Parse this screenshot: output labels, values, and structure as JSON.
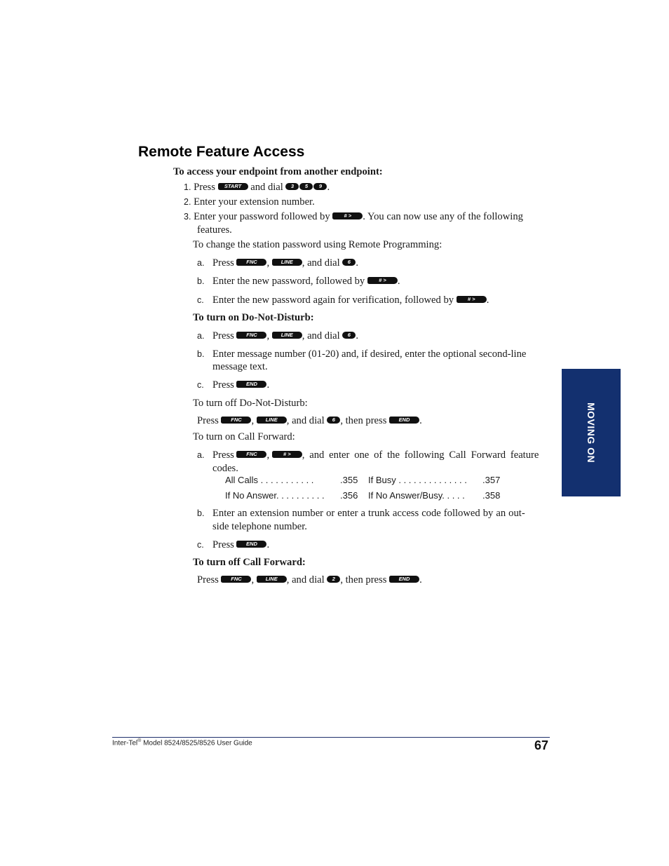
{
  "title": "Remote Feature Access",
  "intro_heading": "To access your endpoint from another endpoint:",
  "steps": [
    {
      "num": "1.",
      "pre": "Press",
      "key1": "START",
      "mid": "and dial",
      "digits": [
        "3",
        "5",
        "9"
      ],
      "post": "."
    },
    {
      "num": "2.",
      "text": "Enter your extension number."
    },
    {
      "num": "3.",
      "pre": "Enter your password followed by",
      "key": "# >",
      "post": ". You can now use any of the following",
      "cont": "features."
    }
  ],
  "change_password": {
    "heading": "To change the station password using Remote Programming:",
    "a": {
      "num": "a.",
      "pre": "Press",
      "key1": "FNC",
      "key2": "LINE",
      "mid": ", and dial",
      "digit": "6",
      "post": "."
    },
    "b": {
      "num": "b.",
      "pre": "Enter the new password, followed by",
      "key": "# >",
      "post": "."
    },
    "c": {
      "num": "c.",
      "pre": "Enter the new password again for verification, followed by",
      "key": "# >",
      "post": "."
    }
  },
  "dnd_on": {
    "heading": "To turn on Do-Not-Disturb:",
    "a": {
      "num": "a.",
      "pre": "Press",
      "key1": "FNC",
      "key2": "LINE",
      "mid": ", and dial",
      "digit": "6",
      "post": "."
    },
    "b": {
      "num": "b.",
      "text": "Enter message number (01-20) and, if desired, enter the optional second-line",
      "cont": "message text."
    },
    "c": {
      "num": "c.",
      "pre": "Press",
      "key": "END",
      "post": "."
    }
  },
  "dnd_off": {
    "heading": "To turn off Do-Not-Disturb:",
    "pre": "Press",
    "key1": "FNC",
    "key2": "LINE",
    "mid": ", and dial",
    "digit": "6",
    "mid2": ", then press",
    "key3": "END",
    "post": "."
  },
  "cf_on": {
    "heading": "To turn on Call Forward:",
    "a": {
      "num": "a.",
      "pre": "Press",
      "key1": "FNC",
      "key2": "# >",
      "post": ", and enter one of the following Call Forward feature",
      "cont": "codes."
    },
    "codes": [
      {
        "label": "All Calls . . . .   .   . . . . . .",
        "code": ".355"
      },
      {
        "label": "If Busy . . . . . . . . . . . . . .",
        "code": ".357"
      },
      {
        "label": "If No Answer. . . . . . . . . .",
        "code": ".356"
      },
      {
        "label": "If No Answer/Busy. . . . .",
        "code": ".358"
      }
    ],
    "b": {
      "num": "b.",
      "text": "Enter an extension number or enter a trunk access code followed by an out-",
      "cont": "side telephone number."
    },
    "c": {
      "num": "c.",
      "pre": "Press",
      "key": "END",
      "post": "."
    }
  },
  "cf_off": {
    "heading": "To turn off Call Forward:",
    "pre": "Press",
    "key1": "FNC",
    "key2": "LINE",
    "mid": ", and dial",
    "digit": "2",
    "mid2": ", then press",
    "key3": "END",
    "post": "."
  },
  "side_tab": {
    "label": "MOVING ON",
    "color": "#13306f"
  },
  "footer": {
    "brand": "Inter-Tel",
    "reg": "®",
    "text": " Model 8524/8525/8526 User Guide",
    "page": "67"
  }
}
